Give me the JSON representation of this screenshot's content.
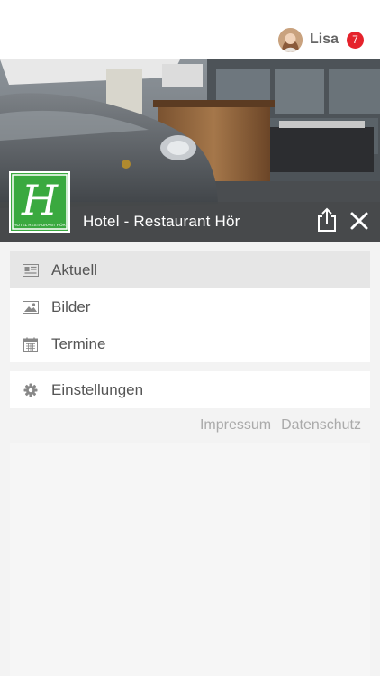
{
  "header": {
    "user_name": "Lisa",
    "notification_count": "7"
  },
  "hero": {
    "title": "Hotel - Restaurant Hör",
    "logo_letter": "H",
    "logo_caption": "HOTEL RESTAURANT HÖR",
    "icons": {
      "share": "share-icon",
      "close": "close-icon"
    }
  },
  "menu": {
    "items": [
      {
        "label": "Aktuell",
        "icon": "newspaper-icon",
        "active": true
      },
      {
        "label": "Bilder",
        "icon": "image-icon",
        "active": false
      },
      {
        "label": "Termine",
        "icon": "calendar-icon",
        "active": false
      }
    ],
    "settings": {
      "label": "Einstellungen",
      "icon": "gear-icon"
    }
  },
  "footer": {
    "impressum": "Impressum",
    "datenschutz": "Datenschutz"
  },
  "colors": {
    "badge": "#e5222b",
    "logo_green": "#3aa93f",
    "active_row": "#e6e6e6"
  }
}
